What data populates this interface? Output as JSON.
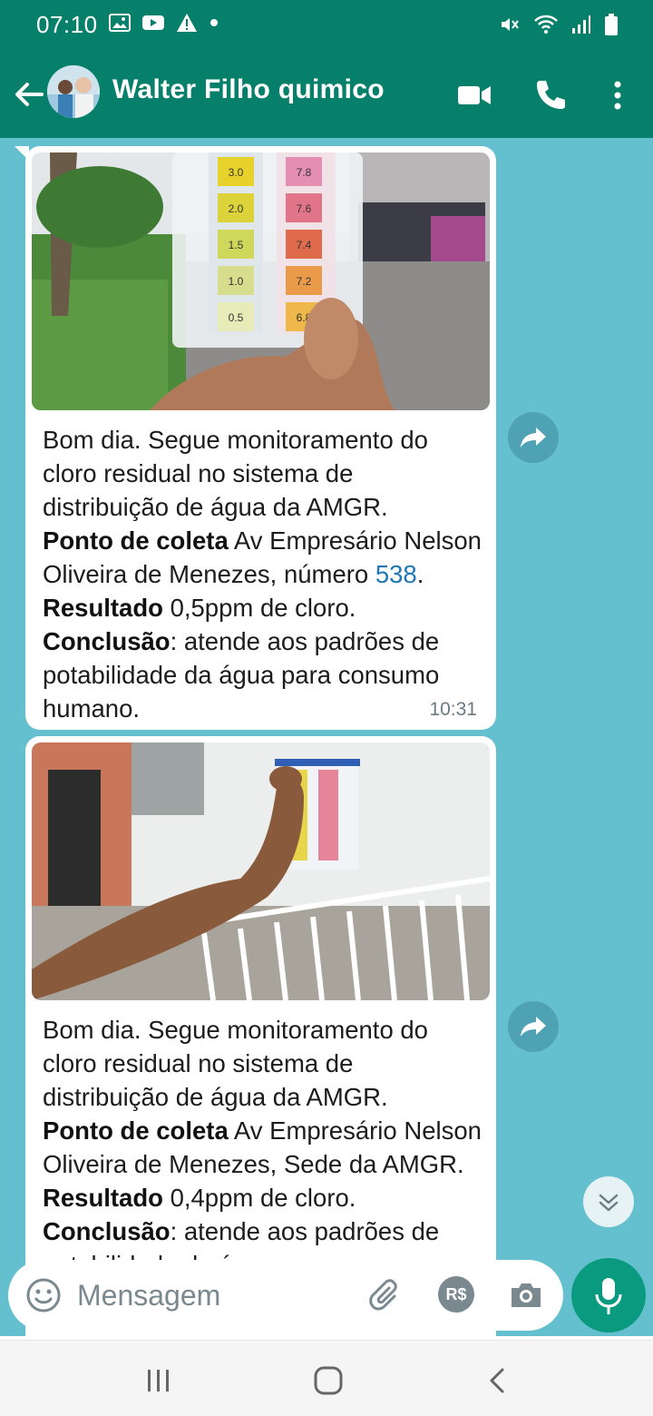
{
  "status_bar": {
    "time": "07:10",
    "left_icons": [
      "gallery-icon",
      "youtube-icon",
      "warning-icon",
      "dot-icon"
    ],
    "right_icons": [
      "mute-icon",
      "wifi-icon",
      "signal-icon",
      "battery-icon"
    ]
  },
  "header": {
    "contact_name": "Walter Filho quimico",
    "icons": [
      "back-arrow-icon",
      "video-call-icon",
      "voice-call-icon",
      "more-icon"
    ]
  },
  "messages": [
    {
      "photo": "chlorine-ph-test-kit-street-photo",
      "test_kit_labels_left": [
        "3.0",
        "2.0",
        "1.5",
        "1.0",
        "0.5"
      ],
      "test_kit_labels_right": [
        "7.8",
        "7.6",
        "7.4",
        "7.2",
        "6.8"
      ],
      "text_intro": "Bom dia. Segue monitoramento do cloro residual no sistema de distribuição de água da AMGR.",
      "label_point": "Ponto de coleta",
      "text_point": " Av Empresário Nelson Oliveira de Menezes, número ",
      "number": "538",
      "text_after_number": ". ",
      "label_result": "Resultado",
      "text_result": " 0,5ppm de cloro.",
      "label_conclusion": "Conclusão",
      "text_conclusion": ": atende aos padrões de potabilidade da água para consumo humano.",
      "time": "10:31"
    },
    {
      "photo": "chlorine-ph-test-kit-building-photo",
      "text_intro": "Bom dia. Segue monitoramento do cloro residual no sistema de distribuição de água da AMGR.",
      "label_point": "Ponto de coleta",
      "text_point": " Av Empresário Nelson Oliveira de Menezes, Sede da AMGR. ",
      "label_result": "Resultado",
      "text_result": " 0,4ppm de cloro. ",
      "label_conclusion": "Conclusão",
      "text_conclusion": ": atende aos padrões de potabilidade da água"
    }
  ],
  "input": {
    "placeholder": "Mensagem",
    "payment_label": "R$",
    "icons": [
      "emoji-icon",
      "attach-icon",
      "payment-icon",
      "camera-icon",
      "mic-icon"
    ]
  },
  "nav": {
    "icons": [
      "recent-apps-icon",
      "home-icon",
      "back-icon"
    ]
  },
  "colors": {
    "header_green": "#06806a",
    "chat_background": "#64bfcf",
    "bubble": "#ffffff",
    "mic_button": "#0a9a80",
    "link_number": "#1f77b4"
  }
}
